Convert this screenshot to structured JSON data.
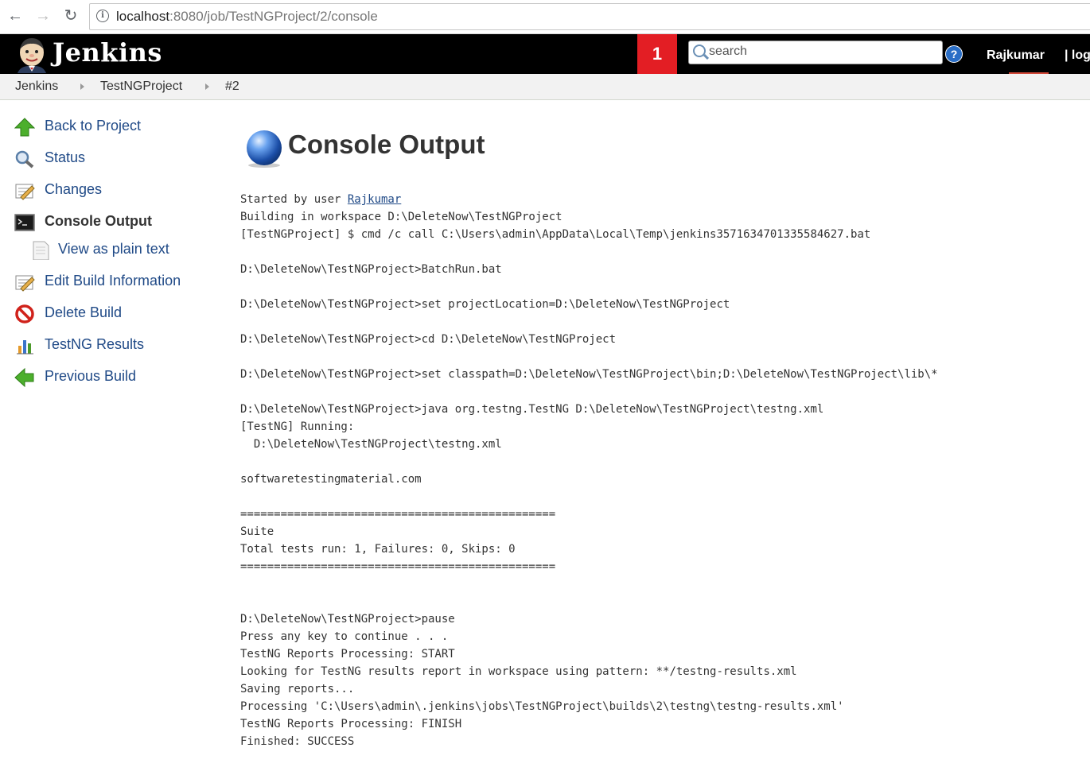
{
  "browser": {
    "url_host": "localhost",
    "url_rest": ":8080/job/TestNGProject/2/console"
  },
  "header": {
    "logo_text": "Jenkins",
    "notification_count": "1",
    "search_placeholder": "search",
    "help_label": "?",
    "user": "Rajkumar",
    "logout": "| log"
  },
  "breadcrumb": [
    "Jenkins",
    "TestNGProject",
    "#2"
  ],
  "sidebar": {
    "items": [
      {
        "label": "Back to Project",
        "icon": "up-arrow-icon"
      },
      {
        "label": "Status",
        "icon": "magnifier-icon"
      },
      {
        "label": "Changes",
        "icon": "notepad-icon"
      },
      {
        "label": "Console Output",
        "icon": "terminal-icon"
      },
      {
        "label": "View as plain text",
        "icon": "document-icon"
      },
      {
        "label": "Edit Build Information",
        "icon": "notepad-icon"
      },
      {
        "label": "Delete Build",
        "icon": "no-entry-icon"
      },
      {
        "label": "TestNG Results",
        "icon": "bar-chart-icon"
      },
      {
        "label": "Previous Build",
        "icon": "left-arrow-icon"
      }
    ]
  },
  "main": {
    "title": "Console Output",
    "console": {
      "started_by_prefix": "Started by user ",
      "started_by_user": "Rajkumar",
      "body": "Building in workspace D:\\DeleteNow\\TestNGProject\n[TestNGProject] $ cmd /c call C:\\Users\\admin\\AppData\\Local\\Temp\\jenkins3571634701335584627.bat\n\nD:\\DeleteNow\\TestNGProject>BatchRun.bat\n\nD:\\DeleteNow\\TestNGProject>set projectLocation=D:\\DeleteNow\\TestNGProject\n\nD:\\DeleteNow\\TestNGProject>cd D:\\DeleteNow\\TestNGProject\n\nD:\\DeleteNow\\TestNGProject>set classpath=D:\\DeleteNow\\TestNGProject\\bin;D:\\DeleteNow\\TestNGProject\\lib\\*\n\nD:\\DeleteNow\\TestNGProject>java org.testng.TestNG D:\\DeleteNow\\TestNGProject\\testng.xml\n[TestNG] Running:\n  D:\\DeleteNow\\TestNGProject\\testng.xml\n\nsoftwaretestingmaterial.com\n\n===============================================\nSuite\nTotal tests run: 1, Failures: 0, Skips: 0\n===============================================\n\n\nD:\\DeleteNow\\TestNGProject>pause\nPress any key to continue . . .\nTestNG Reports Processing: START\nLooking for TestNG results report in workspace using pattern: **/testng-results.xml\nSaving reports...\nProcessing 'C:\\Users\\admin\\.jenkins\\jobs\\TestNGProject\\builds\\2\\testng\\testng-results.xml'\nTestNG Reports Processing: FINISH\nFinished: SUCCESS"
    }
  },
  "colors": {
    "header_bg": "#000000",
    "notification_bg": "#e31e24",
    "link": "#204a87",
    "breadcrumb_bg": "#f2f2f2"
  }
}
